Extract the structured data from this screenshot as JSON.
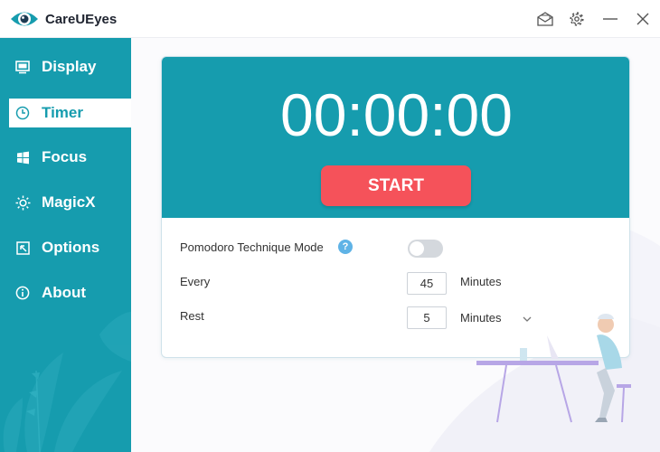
{
  "app": {
    "title": "CareUEyes"
  },
  "titlebar": {
    "icons": [
      "mail-icon",
      "gear-icon",
      "minimize-icon",
      "close-icon"
    ]
  },
  "sidebar": {
    "items": [
      {
        "label": "Display",
        "icon": "monitor-icon",
        "active": false
      },
      {
        "label": "Timer",
        "icon": "clock-icon",
        "active": true
      },
      {
        "label": "Focus",
        "icon": "windows-icon",
        "active": false
      },
      {
        "label": "MagicX",
        "icon": "sun-icon",
        "active": false
      },
      {
        "label": "Options",
        "icon": "options-icon",
        "active": false
      },
      {
        "label": "About",
        "icon": "info-icon",
        "active": false
      }
    ]
  },
  "timer": {
    "display": "00:00:00",
    "start_label": "START",
    "pomodoro_label": "Pomodoro Technique Mode",
    "pomodoro_help": "?",
    "pomodoro_enabled": false,
    "every_label": "Every",
    "every_value": "45",
    "every_unit": "Minutes",
    "rest_label": "Rest",
    "rest_value": "5",
    "rest_unit": "Minutes"
  },
  "colors": {
    "accent": "#169cae",
    "start": "#f5525a",
    "sidebar_text": "#ffffff"
  }
}
